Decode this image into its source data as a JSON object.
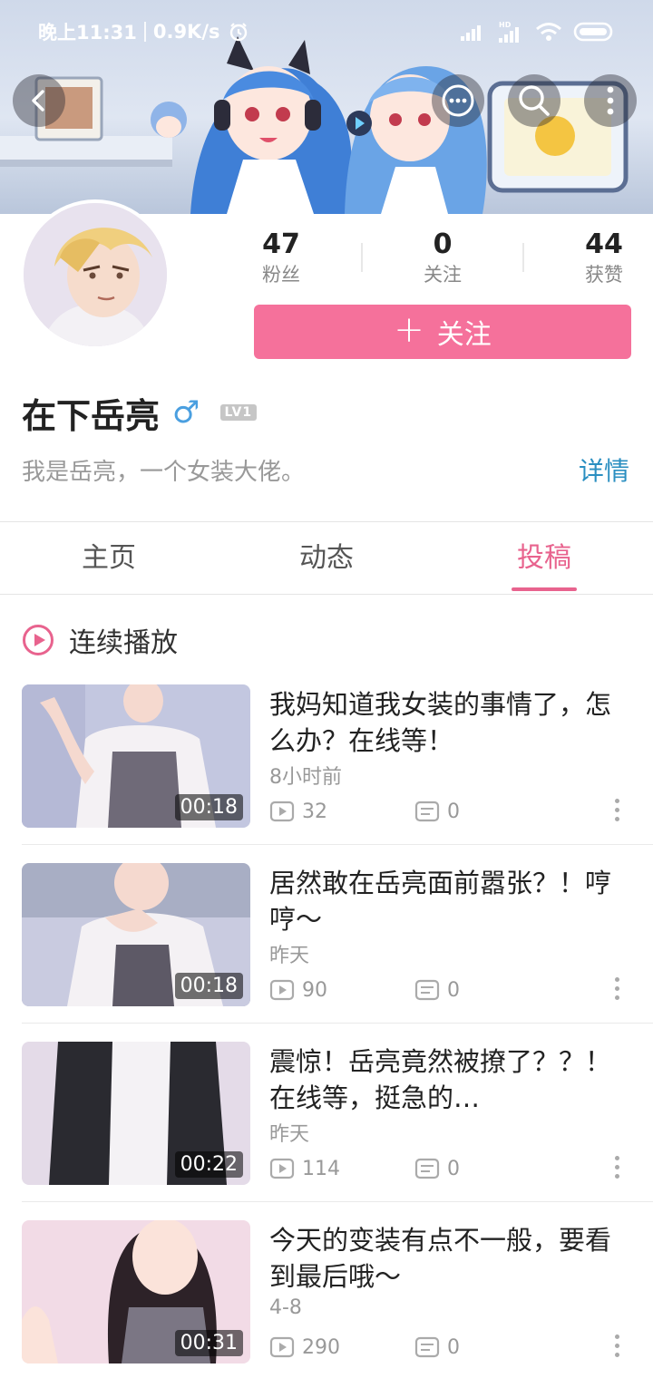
{
  "status_bar": {
    "time": "晚上11:31",
    "speed": "0.9K/s"
  },
  "header": {
    "back_icon": "chevron-left-icon",
    "chat_icon": "chat-bubble-icon",
    "search_icon": "search-icon",
    "more_icon": "more-vertical-icon"
  },
  "profile": {
    "stats": [
      {
        "value": "47",
        "label": "粉丝"
      },
      {
        "value": "0",
        "label": "关注"
      },
      {
        "value": "44",
        "label": "获赞"
      }
    ],
    "follow_button": "关注",
    "name": "在下岳亮",
    "gender_symbol": "♂",
    "level": "LV1",
    "bio": "我是岳亮，一个女装大佬。",
    "details_link": "详情"
  },
  "tabs": [
    {
      "label": "主页",
      "active": false
    },
    {
      "label": "动态",
      "active": false
    },
    {
      "label": "投稿",
      "active": true
    }
  ],
  "autoplay": {
    "label": "连续播放"
  },
  "videos": [
    {
      "title": "我妈知道我女装的事情了，怎么办？在线等！",
      "time": "8小时前",
      "views": "32",
      "comments": "0",
      "duration": "00:18"
    },
    {
      "title": "居然敢在岳亮面前嚣张？！哼哼～",
      "time": "昨天",
      "views": "90",
      "comments": "0",
      "duration": "00:18"
    },
    {
      "title": "震惊！岳亮竟然被撩了？？！在线等，挺急的…",
      "time": "昨天",
      "views": "114",
      "comments": "0",
      "duration": "00:22"
    },
    {
      "title": "今天的变装有点不一般，要看到最后哦～",
      "time": "4-8",
      "views": "290",
      "comments": "0",
      "duration": "00:31"
    }
  ],
  "colors": {
    "accent_pink": "#f5719b",
    "tab_active": "#e8638e",
    "link_blue": "#2b8fc1",
    "gender_blue": "#4a9fe0"
  }
}
